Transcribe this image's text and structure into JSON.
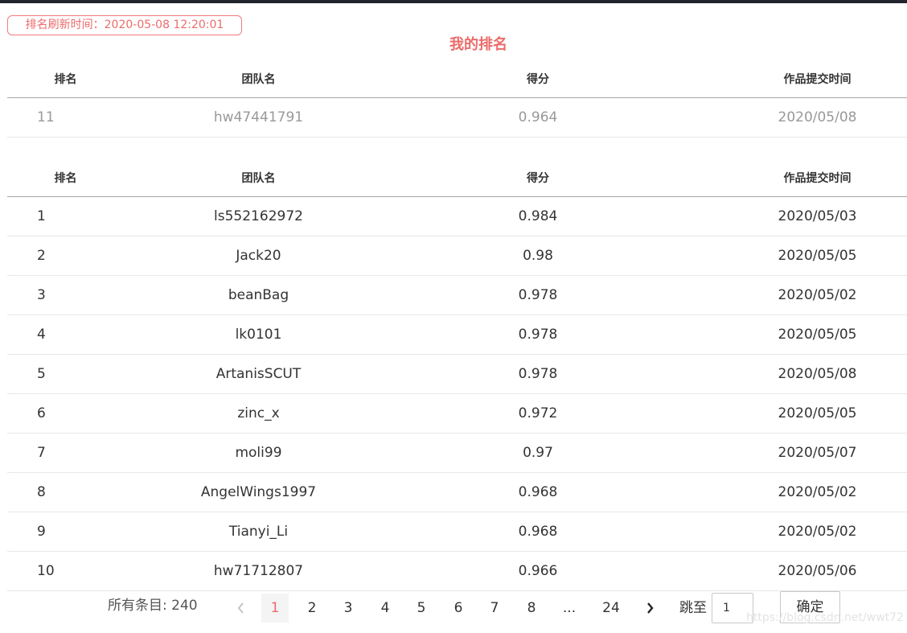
{
  "refresh": {
    "label": "排名刷新时间：2020-05-08 12:20:01"
  },
  "my_rank": {
    "title": "我的排名",
    "row": {
      "rank": "11",
      "team": "hw47441791",
      "score": "0.964",
      "time": "2020/05/08"
    }
  },
  "columns": {
    "rank": "排名",
    "team": "团队名",
    "score": "得分",
    "time": "作品提交时间"
  },
  "rows": [
    {
      "rank": "1",
      "team": "ls552162972",
      "score": "0.984",
      "time": "2020/05/03"
    },
    {
      "rank": "2",
      "team": "Jack20",
      "score": "0.98",
      "time": "2020/05/05"
    },
    {
      "rank": "3",
      "team": "beanBag",
      "score": "0.978",
      "time": "2020/05/02"
    },
    {
      "rank": "4",
      "team": "lk0101",
      "score": "0.978",
      "time": "2020/05/05"
    },
    {
      "rank": "5",
      "team": "ArtanisSCUT",
      "score": "0.978",
      "time": "2020/05/08"
    },
    {
      "rank": "6",
      "team": "zinc_x",
      "score": "0.972",
      "time": "2020/05/05"
    },
    {
      "rank": "7",
      "team": "moli99",
      "score": "0.97",
      "time": "2020/05/07"
    },
    {
      "rank": "8",
      "team": "AngelWings1997",
      "score": "0.968",
      "time": "2020/05/02"
    },
    {
      "rank": "9",
      "team": "Tianyi_Li",
      "score": "0.968",
      "time": "2020/05/02"
    },
    {
      "rank": "10",
      "team": "hw71712807",
      "score": "0.966",
      "time": "2020/05/06"
    }
  ],
  "pagination": {
    "total_label": "所有条目: 240",
    "pages": [
      "1",
      "2",
      "3",
      "4",
      "5",
      "6",
      "7",
      "8",
      "...",
      "24"
    ],
    "active_page": "1",
    "jump_label": "跳至",
    "jump_value": "1",
    "confirm_label": "确定",
    "prev_icon": "chevron-left-icon",
    "next_icon": "chevron-right-icon"
  },
  "watermark": "https://blog.csdn.net/wwt72",
  "colors": {
    "accent": "#ec6b6b",
    "topbar": "#22242e"
  }
}
